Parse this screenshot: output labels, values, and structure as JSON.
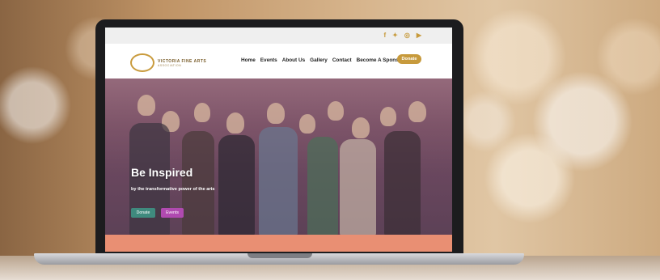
{
  "site": {
    "social_icons": [
      "facebook-icon",
      "twitter-icon",
      "instagram-icon",
      "youtube-icon"
    ],
    "social_glyphs": [
      "f",
      "✦",
      "◎",
      "▶"
    ],
    "logo": {
      "name": "VICTORIA FINE ARTS",
      "tagline": "ASSOCIATION"
    },
    "nav": {
      "items": [
        "Home",
        "Events",
        "About Us",
        "Gallery",
        "Contact",
        "Become A Sponsor"
      ],
      "donate_label": "Donate"
    },
    "hero": {
      "title": "Be Inspired",
      "subtitle": "by the transformative power of the arts",
      "buttons": {
        "donate": "Donate",
        "events": "Events"
      }
    }
  },
  "colors": {
    "gold": "#c79a3c",
    "teal": "#3f8a7e",
    "magenta": "#b04ab0",
    "salmon": "#e98f73"
  }
}
